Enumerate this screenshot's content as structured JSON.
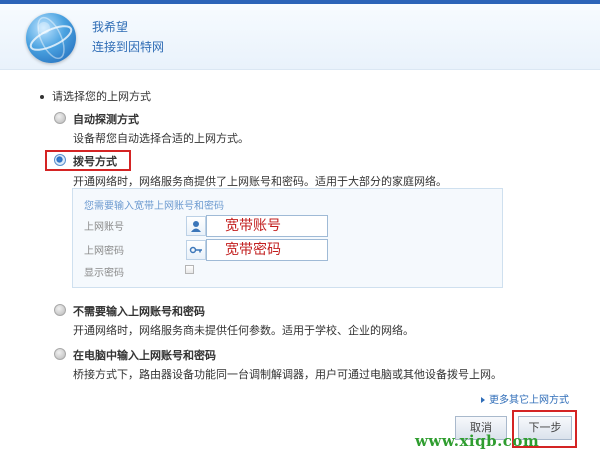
{
  "header": {
    "title": "我希望",
    "subtitle": "连接到因特网"
  },
  "section_title": "请选择您的上网方式",
  "options": [
    {
      "label": "自动探测方式",
      "desc": "设备帮您自动选择合适的上网方式。",
      "selected": false
    },
    {
      "label": "拨号方式",
      "desc": "开通网络时，网络服务商提供了上网账号和密码。适用于大部分的家庭网络。",
      "selected": true
    },
    {
      "label": "不需要输入上网账号和密码",
      "desc": "开通网络时，网络服务商未提供任何参数。适用于学校、企业的网络。",
      "selected": false
    },
    {
      "label": "在电脑中输入上网账号和密码",
      "desc": "桥接方式下，路由器设备功能同一台调制解调器，用户可通过电脑或其他设备拨号上网。",
      "selected": false
    }
  ],
  "pppoe": {
    "hint": "您需要输入宽带上网账号和密码",
    "account_label": "上网账号",
    "account_value": "宽带账号",
    "password_label": "上网密码",
    "password_value": "宽带密码",
    "show_password_label": "显示密码",
    "show_password_checked": false
  },
  "more_link": "更多其它上网方式",
  "buttons": {
    "cancel": "取消",
    "next": "下一步"
  },
  "watermark": "www.xiqb.com",
  "colors": {
    "accent": "#2e6cb5",
    "highlight_border": "#d42424",
    "input_text": "#c21f1f",
    "watermark": "#2f9d2f"
  },
  "icons": [
    "globe-logo",
    "user-icon",
    "key-icon",
    "triangle-right-icon"
  ]
}
